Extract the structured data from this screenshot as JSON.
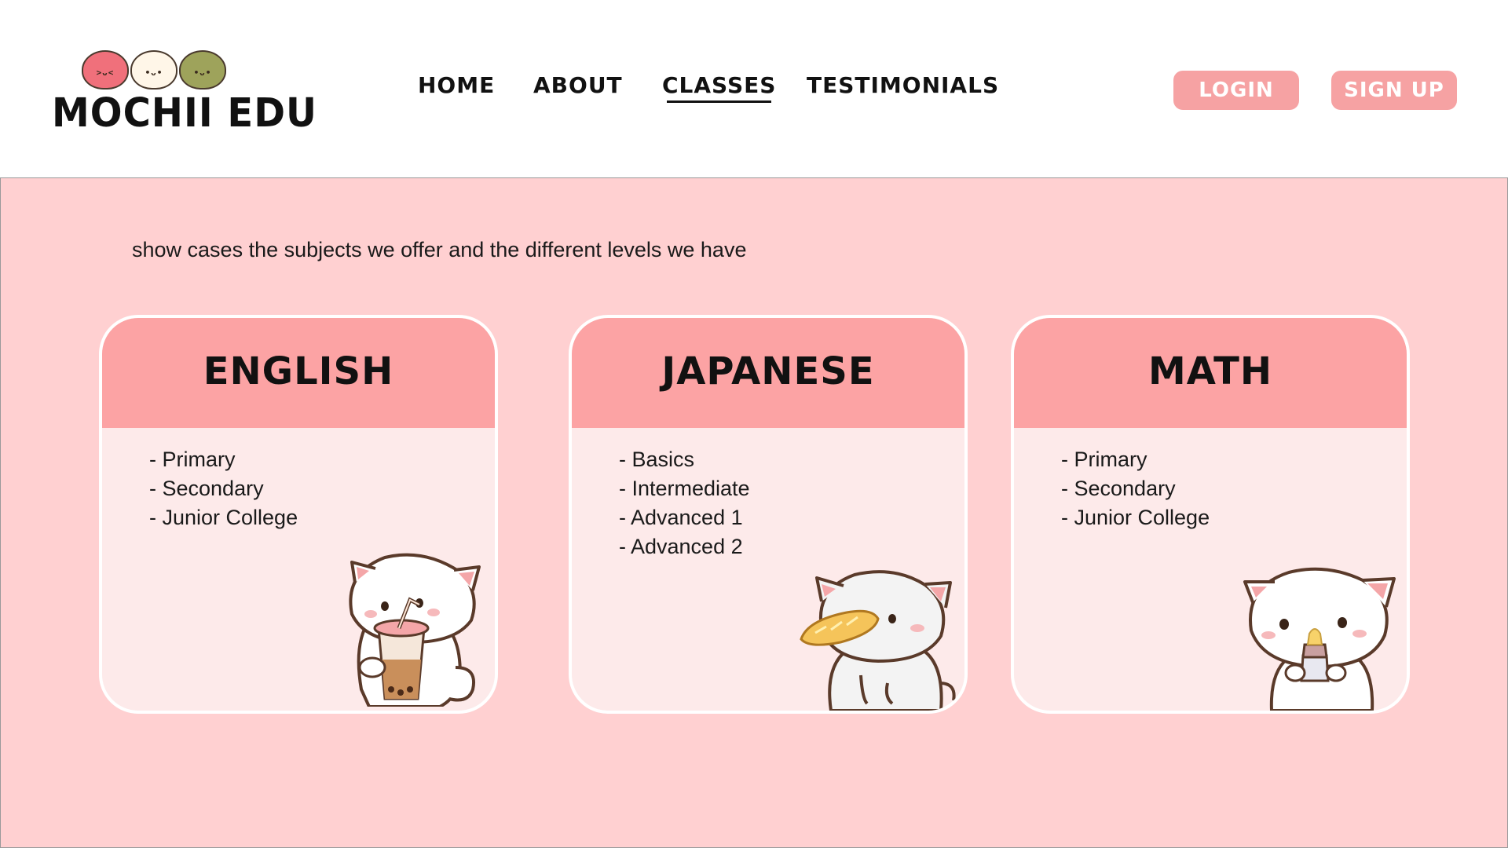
{
  "brand": {
    "name": "MOCHII EDU",
    "mochi_faces": [
      ">ᴗ<",
      "•ᴗ•",
      "•ᴗ•"
    ]
  },
  "nav": {
    "items": [
      {
        "label": "HOME",
        "active": false
      },
      {
        "label": "ABOUT",
        "active": false
      },
      {
        "label": "CLASSES",
        "active": true
      },
      {
        "label": "TESTIMONIALS",
        "active": false
      }
    ]
  },
  "auth": {
    "login_label": "LOGIN",
    "signup_label": "SIGN UP"
  },
  "main": {
    "intro": "show cases the subjects we offer and the different levels we have",
    "cards": [
      {
        "title": "ENGLISH",
        "levels": [
          "- Primary",
          "- Secondary",
          "- Junior College"
        ],
        "illustration": "cat-drinking-boba-icon"
      },
      {
        "title": "JAPANESE",
        "levels": [
          "- Basics",
          "- Intermediate",
          "- Advanced 1",
          "- Advanced 2"
        ],
        "illustration": "cat-eating-bread-icon"
      },
      {
        "title": "MATH",
        "levels": [
          "- Primary",
          "- Secondary",
          "- Junior College"
        ],
        "illustration": "cat-with-bottle-icon"
      }
    ]
  },
  "colors": {
    "accent": "#f6a2a3",
    "card_header": "#fca3a4",
    "card_body": "#fdeaea",
    "background": "#ffd0d1"
  }
}
